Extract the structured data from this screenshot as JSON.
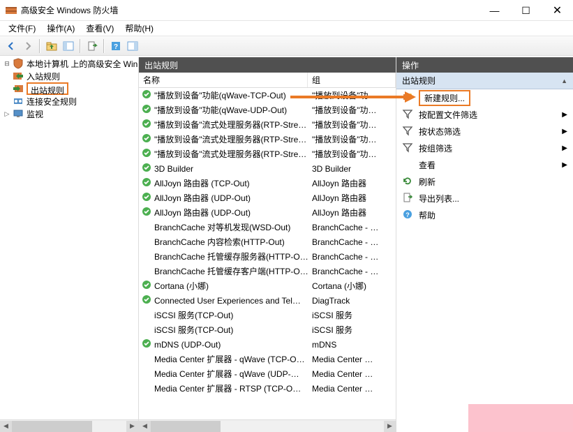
{
  "title": "高级安全 Windows 防火墙",
  "menu": [
    "文件(F)",
    "操作(A)",
    "查看(V)",
    "帮助(H)"
  ],
  "tree": {
    "root": "本地计算机 上的高级安全 Win",
    "children": [
      "入站规则",
      "出站规则",
      "连接安全规则",
      "监视"
    ],
    "selected_index": 1
  },
  "rules": {
    "header": "出站规则",
    "columns": {
      "name": "名称",
      "group": "组"
    },
    "rows": [
      {
        "icon": true,
        "name": "\"播放到设备\"功能(qWave-TCP-Out)",
        "group": "\"播放到设备\"功…"
      },
      {
        "icon": true,
        "name": "\"播放到设备\"功能(qWave-UDP-Out)",
        "group": "\"播放到设备\"功…"
      },
      {
        "icon": true,
        "name": "\"播放到设备\"流式处理服务器(RTP-Stre…",
        "group": "\"播放到设备\"功…"
      },
      {
        "icon": true,
        "name": "\"播放到设备\"流式处理服务器(RTP-Stre…",
        "group": "\"播放到设备\"功…"
      },
      {
        "icon": true,
        "name": "\"播放到设备\"流式处理服务器(RTP-Stre…",
        "group": "\"播放到设备\"功…"
      },
      {
        "icon": true,
        "name": "3D Builder",
        "group": "3D Builder"
      },
      {
        "icon": true,
        "name": "AllJoyn 路由器 (TCP-Out)",
        "group": "AllJoyn 路由器"
      },
      {
        "icon": true,
        "name": "AllJoyn 路由器 (UDP-Out)",
        "group": "AllJoyn 路由器"
      },
      {
        "icon": true,
        "name": "AllJoyn 路由器 (UDP-Out)",
        "group": "AllJoyn 路由器"
      },
      {
        "icon": false,
        "name": "BranchCache 对等机发现(WSD-Out)",
        "group": "BranchCache - …"
      },
      {
        "icon": false,
        "name": "BranchCache 内容检索(HTTP-Out)",
        "group": "BranchCache - …"
      },
      {
        "icon": false,
        "name": "BranchCache 托管缓存服务器(HTTP-O…",
        "group": "BranchCache - …"
      },
      {
        "icon": false,
        "name": "BranchCache 托管缓存客户端(HTTP-O…",
        "group": "BranchCache - …"
      },
      {
        "icon": true,
        "name": "Cortana (小娜)",
        "group": "Cortana (小娜)"
      },
      {
        "icon": true,
        "name": "Connected User Experiences and Tel…",
        "group": "DiagTrack"
      },
      {
        "icon": false,
        "name": "iSCSI 服务(TCP-Out)",
        "group": "iSCSI 服务"
      },
      {
        "icon": false,
        "name": "iSCSI 服务(TCP-Out)",
        "group": "iSCSI 服务"
      },
      {
        "icon": true,
        "name": "mDNS (UDP-Out)",
        "group": "mDNS"
      },
      {
        "icon": false,
        "name": "Media Center 扩展器 - qWave (TCP-O…",
        "group": "Media Center …"
      },
      {
        "icon": false,
        "name": "Media Center 扩展器 - qWave (UDP-…",
        "group": "Media Center …"
      },
      {
        "icon": false,
        "name": "Media Center 扩展器 - RTSP (TCP-O…",
        "group": "Media Center …"
      }
    ]
  },
  "actions": {
    "header": "操作",
    "section": "出站规则",
    "items": [
      {
        "icon": "new",
        "label": "新建规则...",
        "highlight": true
      },
      {
        "icon": "filter",
        "label": "按配置文件筛选",
        "submenu": true
      },
      {
        "icon": "filter",
        "label": "按状态筛选",
        "submenu": true
      },
      {
        "icon": "filter",
        "label": "按组筛选",
        "submenu": true
      },
      {
        "icon": "none",
        "label": "查看",
        "submenu": true
      },
      {
        "icon": "refresh",
        "label": "刷新"
      },
      {
        "icon": "export",
        "label": "导出列表..."
      },
      {
        "icon": "help",
        "label": "帮助"
      }
    ]
  }
}
